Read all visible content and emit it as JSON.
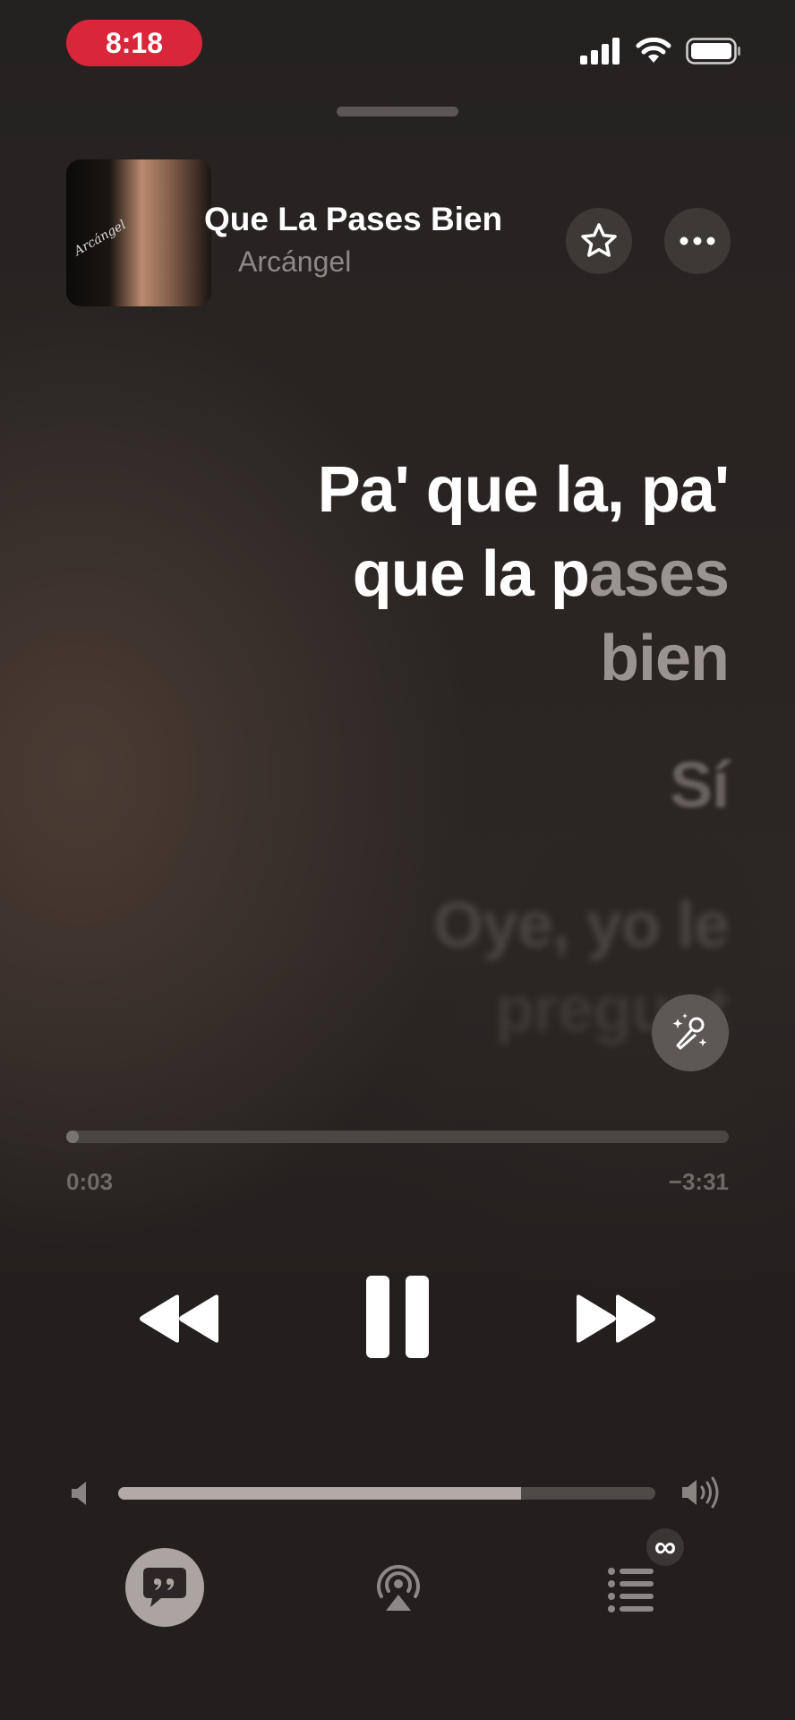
{
  "status_bar": {
    "time": "8:18"
  },
  "now_playing": {
    "title": "Que La Pases Bien",
    "artist": "Arcángel",
    "artwork_signature": "Arcángel"
  },
  "lyrics": {
    "current_line_1": "Pa' que la, pa'",
    "current_line_2_sung": "que la p",
    "current_line_2_unsung": "ases",
    "current_line_3": "bien",
    "next_line": "Sí",
    "following_line_1": "Oye, yo le",
    "following_line_2": "pregunt"
  },
  "playback": {
    "elapsed": "0:03",
    "remaining": "−3:31",
    "progress_fraction": 0.013,
    "state": "playing"
  },
  "volume": {
    "level_fraction": 0.75
  },
  "queue": {
    "badge": "∞"
  },
  "colors": {
    "time_pill": "#d9263a",
    "lyrics_button": "#aca4a0"
  },
  "icons": [
    "cellular-icon",
    "wifi-icon",
    "battery-icon",
    "star-icon",
    "ellipsis-icon",
    "sing-mic-icon",
    "rewind-icon",
    "pause-icon",
    "fast-forward-icon",
    "speaker-low-icon",
    "speaker-high-icon",
    "lyrics-quote-icon",
    "airplay-icon",
    "queue-list-icon"
  ]
}
